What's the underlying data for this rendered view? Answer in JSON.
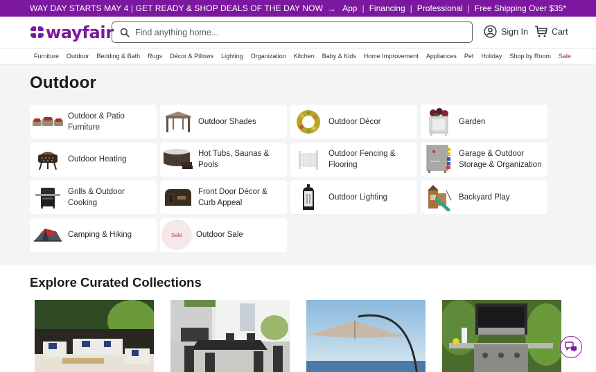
{
  "promo": {
    "message": "WAY DAY STARTS MAY 4 | GET READY & SHOP DEALS OF THE DAY NOW",
    "arrow_icon": "arrow-right-icon",
    "links": [
      "App",
      "Financing",
      "Professional",
      "Free Shipping Over $35*"
    ],
    "separator": "|"
  },
  "header": {
    "logo_text": "wayfair",
    "search_placeholder": "Find anything home...",
    "search_value": "",
    "sign_in_label": "Sign In",
    "cart_label": "Cart"
  },
  "nav": {
    "items": [
      "Furniture",
      "Outdoor",
      "Bedding & Bath",
      "Rugs",
      "Décor & Pillows",
      "Lighting",
      "Organization",
      "Kitchen",
      "Baby & Kids",
      "Home Improvement",
      "Appliances",
      "Pet",
      "Holiday",
      "Shop by Room",
      "Sale"
    ]
  },
  "main": {
    "title": "Outdoor",
    "categories": [
      {
        "label": "Outdoor & Patio Furniture",
        "icon": "patio-furniture-image"
      },
      {
        "label": "Outdoor Shades",
        "icon": "gazebo-image"
      },
      {
        "label": "Outdoor Décor",
        "icon": "wreath-image"
      },
      {
        "label": "Garden",
        "icon": "planter-image"
      },
      {
        "label": "Outdoor Heating",
        "icon": "fire-pit-image"
      },
      {
        "label": "Hot Tubs, Saunas & Pools",
        "icon": "hot-tub-image"
      },
      {
        "label": "Outdoor Fencing & Flooring",
        "icon": "fence-image"
      },
      {
        "label": "Garage & Outdoor Storage & Organization",
        "icon": "pegboard-image"
      },
      {
        "label": "Grills & Outdoor Cooking",
        "icon": "grill-image"
      },
      {
        "label": "Front Door Décor & Curb Appeal",
        "icon": "mailbox-image"
      },
      {
        "label": "Outdoor Lighting",
        "icon": "lantern-image"
      },
      {
        "label": "Backyard Play",
        "icon": "playset-image"
      },
      {
        "label": "Camping & Hiking",
        "icon": "tent-image"
      },
      {
        "label": "Outdoor Sale",
        "icon": "sale-badge",
        "badge_text": "Sale"
      }
    ]
  },
  "collections": {
    "title": "Explore Curated Collections",
    "items": [
      {
        "name": "patio-seating-collection"
      },
      {
        "name": "patio-dining-collection"
      },
      {
        "name": "umbrella-collection"
      },
      {
        "name": "grill-collection"
      }
    ]
  },
  "colors": {
    "brand": "#7b189f",
    "sale": "#a8174a",
    "page_bg": "#f4f4f4"
  }
}
